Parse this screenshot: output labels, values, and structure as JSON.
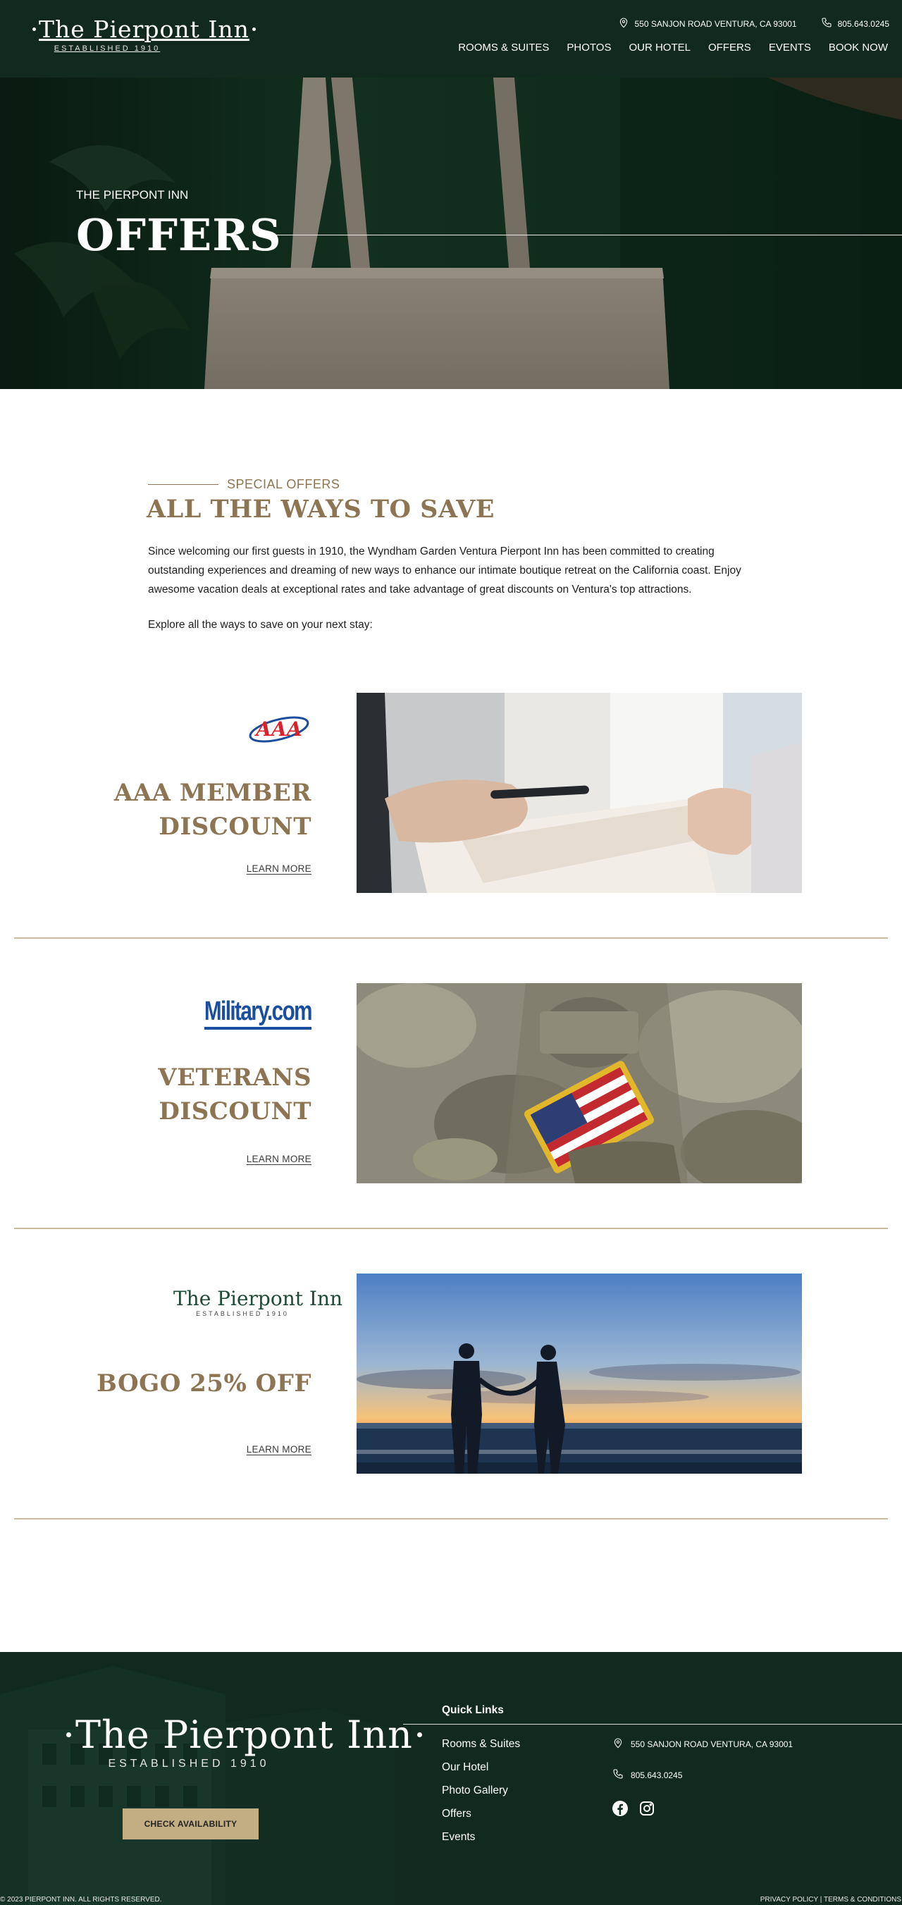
{
  "header": {
    "logo": {
      "name": "The Pierpont Inn",
      "tagline": "ESTABLISHED 1910"
    },
    "address": "550 SANJON ROAD VENTURA, CA 93001",
    "phone": "805.643.0245",
    "nav": [
      "ROOMS & SUITES",
      "PHOTOS",
      "OUR HOTEL",
      "OFFERS",
      "EVENTS",
      "BOOK NOW"
    ]
  },
  "hero": {
    "eyebrow": "THE PIERPONT INN",
    "title": "OFFERS"
  },
  "intro": {
    "eyebrow": "SPECIAL OFFERS",
    "title": "ALL THE WAYS TO SAVE",
    "body": "Since welcoming our first guests in 1910, the Wyndham Garden Ventura Pierpont Inn has been committed to creating outstanding experiences and dreaming of new ways to enhance our intimate boutique retreat on the California coast. Enjoy awesome vacation deals at exceptional rates and take advantage of great discounts on Ventura's top attractions.",
    "cta": "Explore all the ways to save on your next stay:"
  },
  "offers": [
    {
      "logo_text": "AAA",
      "title_line1": "AAA MEMBER",
      "title_line2": "DISCOUNT",
      "link": "LEARN MORE"
    },
    {
      "logo_text": "Military.com",
      "title_line1": "VETERANS",
      "title_line2": "DISCOUNT",
      "link": "LEARN MORE"
    },
    {
      "logo_name": "The Pierpont Inn",
      "logo_tagline": "ESTABLISHED 1910",
      "title_line1": "BOGO 25% OFF",
      "link": "LEARN MORE"
    }
  ],
  "footer": {
    "logo": {
      "name": "The Pierpont Inn",
      "tagline": "ESTABLISHED 1910"
    },
    "button": "CHECK AVAILABILITY",
    "quick_links_title": "Quick Links",
    "quick_links": [
      "Rooms & Suites",
      "Our Hotel",
      "Photo Gallery",
      "Offers",
      "Events"
    ],
    "address": "550 SANJON ROAD VENTURA, CA 93001",
    "phone": "805.643.0245",
    "social": [
      "facebook-icon",
      "instagram-icon"
    ],
    "copyright": "© 2023 PIERPONT INN. ALL RIGHTS RESERVED.",
    "privacy": "PRIVACY POLICY",
    "terms": "TERMS & CONDITIONS"
  },
  "colors": {
    "header_bg": "#11291f",
    "accent_gold": "#8d7553",
    "button_gold": "#c3ad82",
    "divider": "#c8bba2"
  }
}
